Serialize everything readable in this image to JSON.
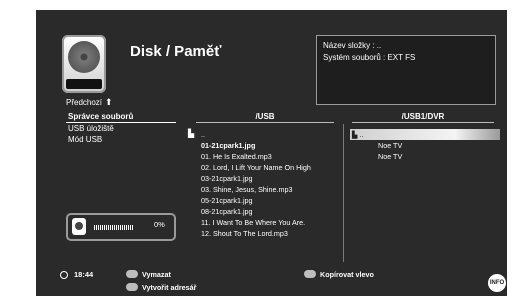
{
  "header": {
    "title": "Disk / Paměť",
    "info_folder": "Název složky : ..",
    "info_fs": "Systém souborů : EXT FS",
    "prev_label": "Předchozí"
  },
  "menu": {
    "items": [
      {
        "label": "Správce souborů",
        "active": true
      },
      {
        "label": "USB úložiště",
        "active": false
      },
      {
        "label": "Mód USB",
        "active": false
      }
    ]
  },
  "panels": {
    "usb": {
      "header": "/USB",
      "files": [
        {
          "name": "..",
          "type": "folder"
        },
        {
          "name": "01-21cpark1.jpg",
          "type": "file",
          "highlight": true
        },
        {
          "name": "01. He Is Exalted.mp3",
          "type": "file"
        },
        {
          "name": "02. Lord, I Lift Your Name On High",
          "type": "file"
        },
        {
          "name": "03-21cpark1.jpg",
          "type": "file"
        },
        {
          "name": "03. Shine, Jesus, Shine.mp3",
          "type": "file"
        },
        {
          "name": "05-21cpark1.jpg",
          "type": "file"
        },
        {
          "name": "08-21cpark1.jpg",
          "type": "file"
        },
        {
          "name": "11. I Want To Be Where You Are.",
          "type": "file"
        },
        {
          "name": "12. Shout To The Lord.mp3",
          "type": "file"
        }
      ]
    },
    "dvr": {
      "header": "/USB1/DVR",
      "files": [
        {
          "name": "..",
          "type": "folder",
          "selected": true
        },
        {
          "name": "Noe TV",
          "type": "file"
        },
        {
          "name": "Noe TV",
          "type": "file"
        }
      ]
    }
  },
  "progress": {
    "percent_label": "0%",
    "fraction": 0
  },
  "footer": {
    "time": "18:44",
    "delete_label": "Vymazat",
    "mkdir_label": "Vytvořit adresář",
    "copy_label": "Kopírovat vlevo",
    "info_label": "INFO"
  }
}
